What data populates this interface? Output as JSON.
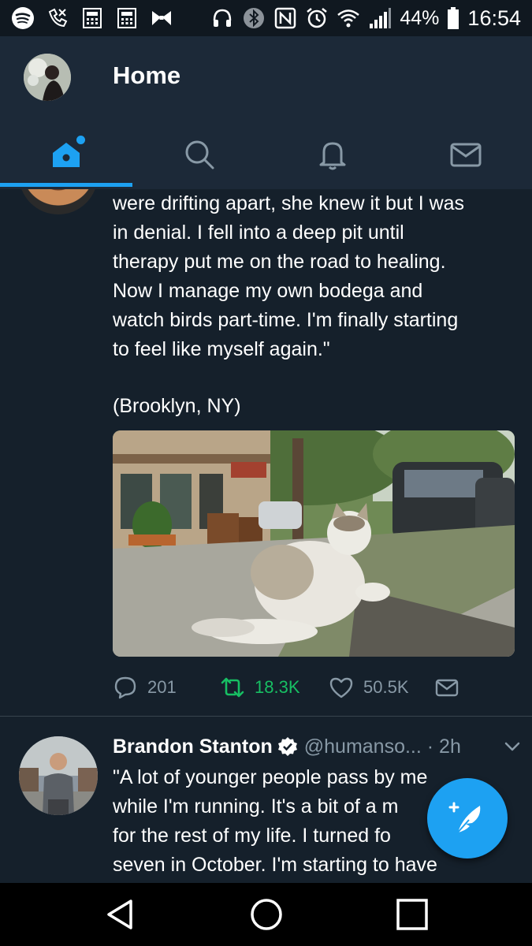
{
  "status_bar": {
    "icons_left": [
      "spotify-icon",
      "phone-missed-icon",
      "calculator-icon",
      "calculator-icon",
      "bowtie-icon"
    ],
    "icons_right": [
      "headset-icon",
      "bluetooth-icon",
      "nfc-icon",
      "alarm-icon",
      "wifi-icon",
      "signal-icon"
    ],
    "battery": "44%",
    "time": "16:54"
  },
  "header": {
    "title": "Home",
    "tabs": [
      {
        "name": "home",
        "icon": "home-icon",
        "active": true
      },
      {
        "name": "search",
        "icon": "search-icon",
        "active": false
      },
      {
        "name": "notifications",
        "icon": "bell-icon",
        "active": false
      },
      {
        "name": "messages",
        "icon": "mail-icon",
        "active": false
      }
    ]
  },
  "tweet1": {
    "lines": [
      "were drifting apart, she knew it but I was",
      "in denial. I fell into a deep pit until",
      "therapy put me on the road to healing.",
      "Now I manage my own bodega and",
      "watch birds part-time. I'm finally starting",
      "to feel like myself again.\""
    ],
    "location": "(Brooklyn, NY)",
    "media": "photo of a cat sitting on a sidewalk",
    "replies": "201",
    "retweets": "18.3K",
    "likes": "50.5K"
  },
  "tweet2": {
    "name": "Brandon Stanton",
    "handle": "@humanso... · 2h",
    "lines": [
      "\"A lot of younger people pass by me",
      "while I'm running. It's a bit of a m",
      "for the rest of my life. I turned fo",
      "seven in October. I'm starting to have"
    ]
  },
  "colors": {
    "accent": "#1da1f2",
    "background": "#15202b",
    "header": "#1c2938",
    "muted": "#8899a6",
    "retweet_green": "#17bf63"
  }
}
